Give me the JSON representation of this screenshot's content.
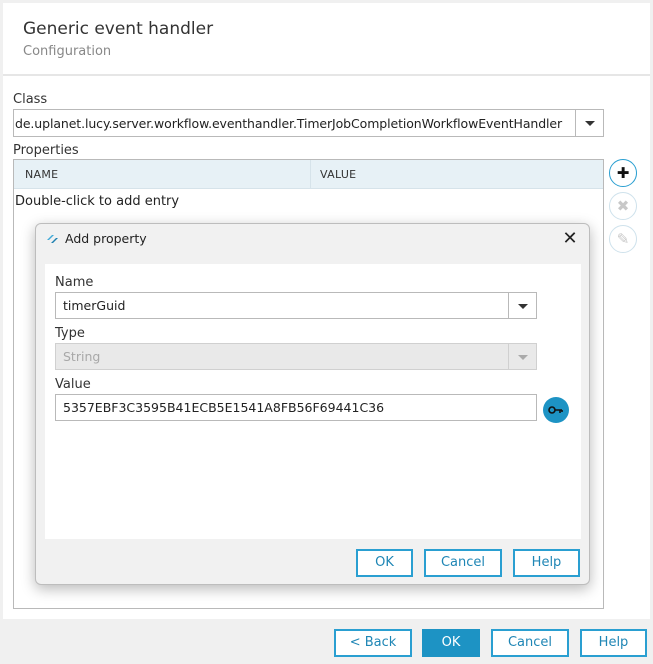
{
  "header": {
    "title": "Generic event handler",
    "subtitle": "Configuration"
  },
  "class_field": {
    "label": "Class",
    "value": "de.uplanet.lucy.server.workflow.eventhandler.TimerJobCompletionWorkflowEventHandler"
  },
  "properties": {
    "label": "Properties",
    "columns": [
      "NAME",
      "VALUE"
    ],
    "empty_hint": "Double-click to add entry",
    "side_buttons": {
      "add_icon": "plus-icon",
      "delete_icon": "close-circle-icon",
      "edit_icon": "pencil-icon"
    }
  },
  "dialog": {
    "title": "Add property",
    "name_label": "Name",
    "name_value": "timerGuid",
    "type_label": "Type",
    "type_value": "String",
    "value_label": "Value",
    "value_value": "5357EBF3C3595B41ECB5E1541A8FB56F69441C36",
    "key_button_icon": "key-icon",
    "ok_label": "OK",
    "cancel_label": "Cancel",
    "help_label": "Help"
  },
  "footer": {
    "back_label": "< Back",
    "ok_label": "OK",
    "cancel_label": "Cancel",
    "help_label": "Help"
  },
  "colors": {
    "accent": "#1d93c4",
    "table_header": "#e7f1f6"
  }
}
